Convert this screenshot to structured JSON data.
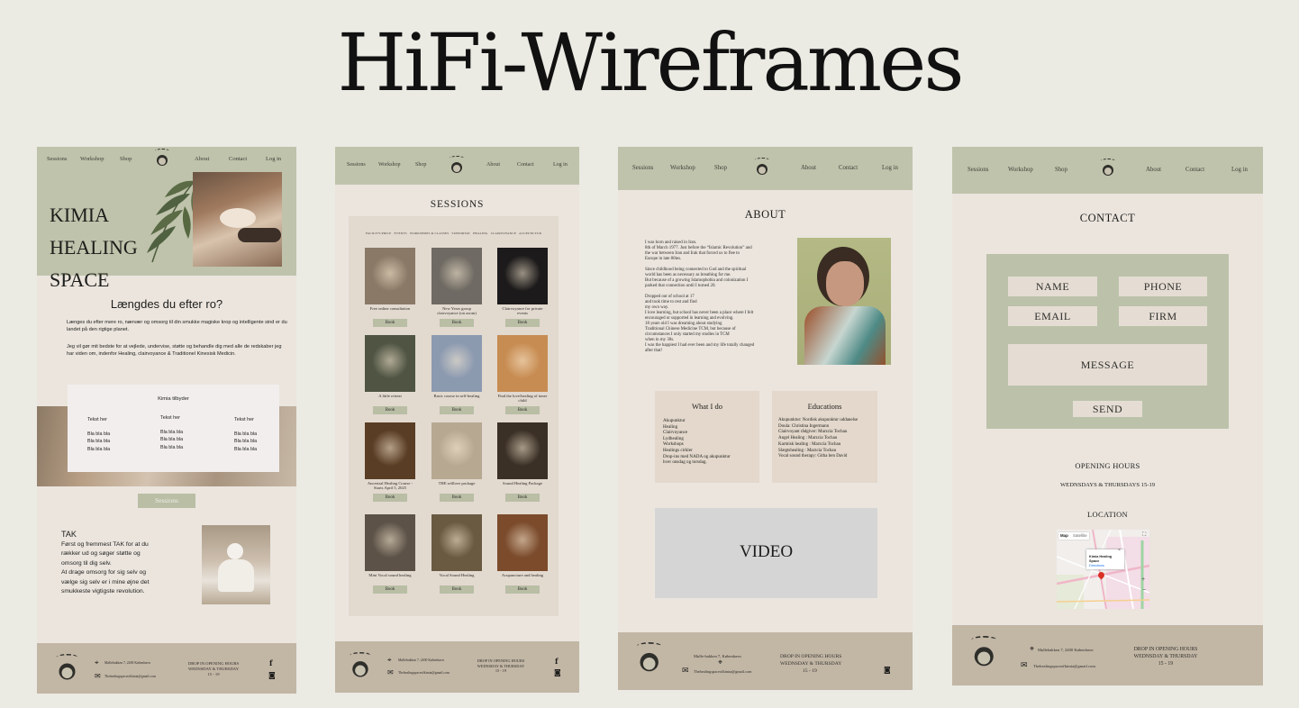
{
  "page_title": "HiFi-Wireframes",
  "nav": {
    "sessions": "Sessions",
    "workshop": "Workshop",
    "shop": "Shop",
    "about": "About",
    "contact": "Contact",
    "login": "Log in"
  },
  "logo_text": "KIMIA",
  "frame1": {
    "hero_title": [
      "KIMIA",
      "HEALING",
      "SPACE"
    ],
    "heading": "Længdes du efter ro?",
    "para1": "Længes du efter mere ro, nærvær og omsorg til din smukke magiske krop og intelligente sind er du landet på den rigtige planet.",
    "para2": "Jeg vil gør mit bedste for at vejlede, undervise, støtte og behandle dig  med alle de redskaber jeg har viden om, indenfor Healing, clairvoyance  & Traditionel Kinesisk Medicin.",
    "offers_title": "Kimia tilbyder",
    "columns": [
      {
        "head": "Tekst her",
        "lines": [
          "Bla bla bla",
          "Bla bla bla",
          "Bla bla bla"
        ]
      },
      {
        "head": "Tekst her",
        "lines": [
          "Bla bla bla",
          "Bla bla bla",
          "Bla bla bla"
        ]
      },
      {
        "head": "Tekst her",
        "lines": [
          "Bla bla bla",
          "Bla bla bla",
          "Bla bla bla"
        ]
      }
    ],
    "sessions_button": "Sessions",
    "thanks_title": "TAK",
    "thanks_text": [
      "Først og fremmest TAK for at du",
      "rækker ud og søger støtte og",
      "omsorg til dig selv.",
      "At drage omsorg for sig selv og",
      "vælge sig selv er i mine øjne det",
      "smukkeste vigtigste revolution."
    ]
  },
  "frame2": {
    "heading": "SESSIONS",
    "filters": [
      "FACILITY/PRICE",
      "EVENTS",
      "WORKSHOPS & CLASSES",
      "SUPPORTAT",
      "HEALING",
      "CLAIRVOYANCE",
      "ACUPUNCTUR"
    ],
    "cards": [
      {
        "caption": "Free online consultation",
        "color": "#8a7966"
      },
      {
        "caption": "New Years group clairvoyance (on zoom)",
        "color": "#6f6a63"
      },
      {
        "caption": "Clairvoyance for private events",
        "color": "#1c1a1a"
      },
      {
        "caption": "A little retreat",
        "color": "#4f5443"
      },
      {
        "caption": "Basic course in self-healing",
        "color": "#8c9ab0"
      },
      {
        "caption": "Find the love/healing of inner child",
        "color": "#c78c52"
      },
      {
        "caption": "Ancestral Healing Course - Starts April 5, 2025",
        "color": "#5a3d25"
      },
      {
        "caption": "THE selflove package",
        "color": "#b7a892"
      },
      {
        "caption": "Sound Healing Package",
        "color": "#3b3026"
      },
      {
        "caption": "Mini Vocal sound healing",
        "color": "#5c5247"
      },
      {
        "caption": "Vocal Sound Healing",
        "color": "#6a5a42"
      },
      {
        "caption": "Acupuncture and healing",
        "color": "#7b4b2c"
      }
    ],
    "book_label": "Book"
  },
  "frame3": {
    "heading": "ABOUT",
    "bio": [
      "I was born and raised in Iran.",
      "8th of March 1977. Just before the “Islamic Revolution” and",
      "the war between Iran and Irak that forced us to flee to",
      "Europe in late 80ies.",
      "",
      "Since childhood being connected to God and the spiritual",
      "world has been as necessary as breathing for me.",
      "But because of a growing Islamophobia and colonization I",
      "parked that connection until I turned 20.",
      "",
      "Dropped out of school at 17",
      "and took time to rest and find",
      "my own way.",
      "I love learning, but school has never been a place where I felt",
      "encouraged or supported in learning and evolving.",
      " 18 years old I was dreaming about studying",
      "Traditional Chinese Medicine TCM, but because of",
      "circumstances I only started my studies in TCM",
      "when in my 30s.",
      "I was the happiest I had ever been and my life totally changed",
      "after that!"
    ],
    "what_title": "What I do",
    "what_items": [
      "Akupunktur",
      "Healing",
      "Clairvoyance",
      "Lydhealing",
      "Workshops",
      "Healings cirkler",
      "Drop-ins med NADA og akupunktur",
      "hver onsdag og torsdag."
    ],
    "edu_title": "Educations",
    "edu_items": [
      "Akupunktur: Nordisk akupunktur uddanelse",
      "Doula: Christina Ingermann",
      "Clairvoyant rådgiver: Marzcia Tochau",
      "Angel Healing : Marzcia Tochau",
      "Karmisk healing : Marzcia Tochau",
      "Slægtshealing : Marzcia Tochau",
      "Vocal sound therapy: Githa ben David"
    ],
    "video_label": "VIDEO"
  },
  "frame4": {
    "heading": "CONTACT",
    "name": "NAME",
    "phone": "PHONE",
    "email": "EMAIL",
    "firm": "FIRM",
    "message": "MESSAGE",
    "send": "SEND",
    "opening_title": "OPENING HOURS",
    "opening_text": "WEDNSDAYS & THURSDAYS 15-19",
    "location_title": "LOCATION",
    "map_tab_map": "Map",
    "map_tab_sat": "Satellite",
    "map_place": "Kimia Healing Space",
    "map_directions": "Directions"
  },
  "footers": {
    "f1_address": "Møllebakken 7, 2400 København",
    "f1_email": "Thehealingspaceofkimia@gmail.com",
    "f1_hours": [
      "DROP IN OPENING HOURS",
      "WEDNSDAY & THURSDAY",
      "15 - 19"
    ],
    "f2_address": "Møllebakken 7, 2400 København",
    "f2_email": "Thehealingspaceofkimia@gmail.com",
    "f2_hours": [
      "DROP IN OPENING HOURS",
      "WEDNSDAY & THURSDAY",
      "15 - 19"
    ],
    "f3_address": "Mølle-bakken 7, København",
    "f3_email": "Thehealingspaceofkimia@gmail.com",
    "f3_hours": [
      "DROP IN OPENING HOURS",
      "WEDNSDAY & THURSDAY",
      "15 - 19"
    ],
    "f4_address": "Møllebakken 7, 2400 København",
    "f4_email": "Thehealingspaceofkimia@gmail.com",
    "f4_hours": [
      "DROP IN OPENING HOURS",
      "WEDNSDAY & THURSDAY",
      "15 - 19"
    ]
  }
}
